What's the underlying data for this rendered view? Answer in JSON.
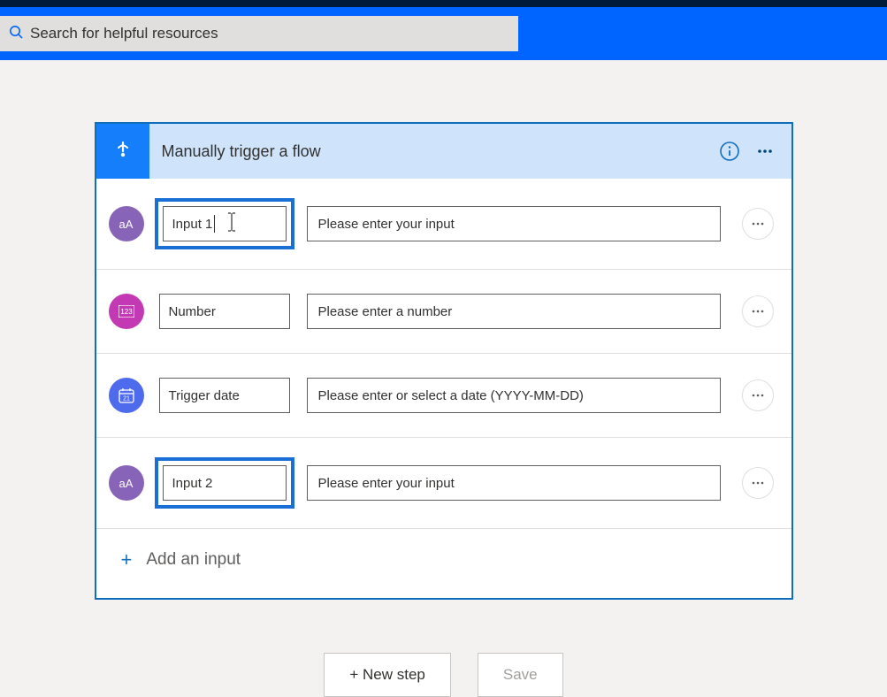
{
  "search": {
    "placeholder": "Search for helpful resources"
  },
  "card": {
    "title": "Manually trigger a flow",
    "inputs": [
      {
        "name": "Input 1",
        "placeholder": "Please enter your input",
        "icon": "text",
        "highlight": true,
        "caret": true
      },
      {
        "name": "Number",
        "placeholder": "Please enter a number",
        "icon": "num",
        "highlight": false,
        "caret": false
      },
      {
        "name": "Trigger date",
        "placeholder": "Please enter or select a date (YYYY-MM-DD)",
        "icon": "date",
        "highlight": false,
        "caret": false
      },
      {
        "name": "Input 2",
        "placeholder": "Please enter your input",
        "icon": "text",
        "highlight": true,
        "caret": false
      }
    ],
    "add_label": "Add an input"
  },
  "footer": {
    "new_step": "+ New step",
    "save": "Save"
  }
}
